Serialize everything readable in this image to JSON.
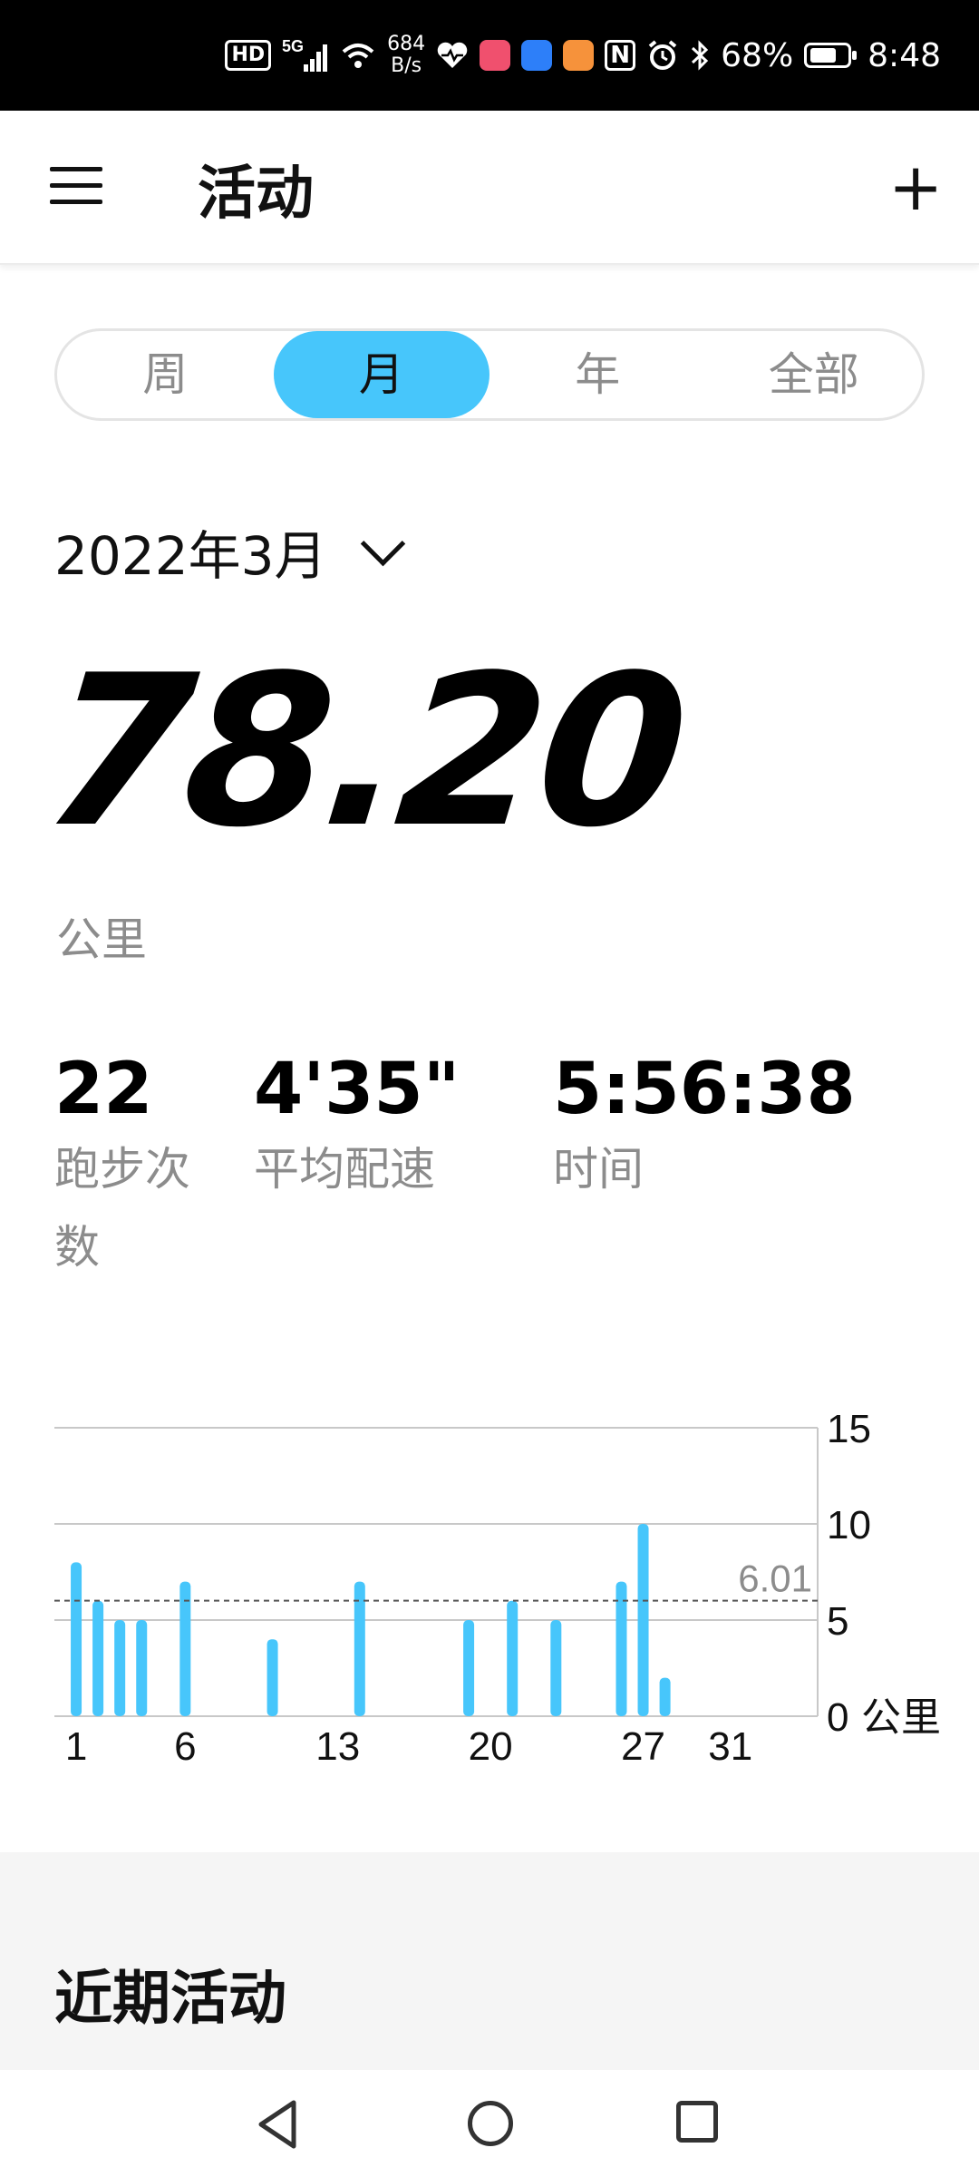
{
  "status_bar": {
    "hd": "HD",
    "signal": "5G",
    "speed_top": "684",
    "speed_bottom": "B/s",
    "battery": "68%",
    "time": "8:48",
    "icons": [
      "hd-icon",
      "signal-icon",
      "wifi-icon",
      "health-icon",
      "book-app-icon",
      "bulb-app-icon",
      "heart-app-icon",
      "nfc-icon",
      "alarm-icon",
      "bluetooth-icon",
      "battery-icon"
    ],
    "colors": {
      "book_app": "#f0506e",
      "bulb_app": "#2d7ff9",
      "heart_app": "#f6923b"
    }
  },
  "app_bar": {
    "title": "活动",
    "menu_icon": "hamburger-menu-icon",
    "add_icon": "plus-icon",
    "add_label": "+"
  },
  "tabs": [
    {
      "label": "周",
      "active": false
    },
    {
      "label": "月",
      "active": true
    },
    {
      "label": "年",
      "active": false
    },
    {
      "label": "全部",
      "active": false
    }
  ],
  "accent_color": "#47c6fb",
  "month_selector": {
    "label": "2022年3月",
    "icon": "chevron-down-icon"
  },
  "summary": {
    "total_distance": "78.20",
    "unit": "公里"
  },
  "stats": {
    "runs": {
      "value": "22",
      "label": "跑步次数"
    },
    "pace": {
      "value": "4'35\"",
      "label": "平均配速"
    },
    "time": {
      "value": "5:56:38",
      "label": "时间"
    }
  },
  "chart_data": {
    "type": "bar",
    "x": [
      1,
      2,
      3,
      4,
      6,
      10,
      14,
      19,
      21,
      23,
      26,
      27,
      28
    ],
    "values": [
      8.0,
      6.0,
      5.0,
      5.0,
      7.0,
      4.0,
      7.0,
      5.0,
      6.0,
      5.0,
      7.0,
      10.0,
      2.0
    ],
    "x_tick_labels": [
      "1",
      "6",
      "13",
      "20",
      "27",
      "31"
    ],
    "x_ticks": [
      1,
      6,
      13,
      20,
      27,
      31
    ],
    "xlim": [
      0,
      35
    ],
    "y_ticks": [
      0,
      5,
      10,
      15
    ],
    "y_tick_labels": [
      "0",
      "5",
      "10",
      "15"
    ],
    "ylim": [
      0,
      15
    ],
    "ylabel": "公里",
    "average": 6.01,
    "average_label": "6.01",
    "color": "#47c6fb",
    "grid": true
  },
  "recent": {
    "title": "近期活动"
  },
  "nav_bar": {
    "icons": [
      "back-icon",
      "home-icon",
      "recents-icon"
    ]
  }
}
